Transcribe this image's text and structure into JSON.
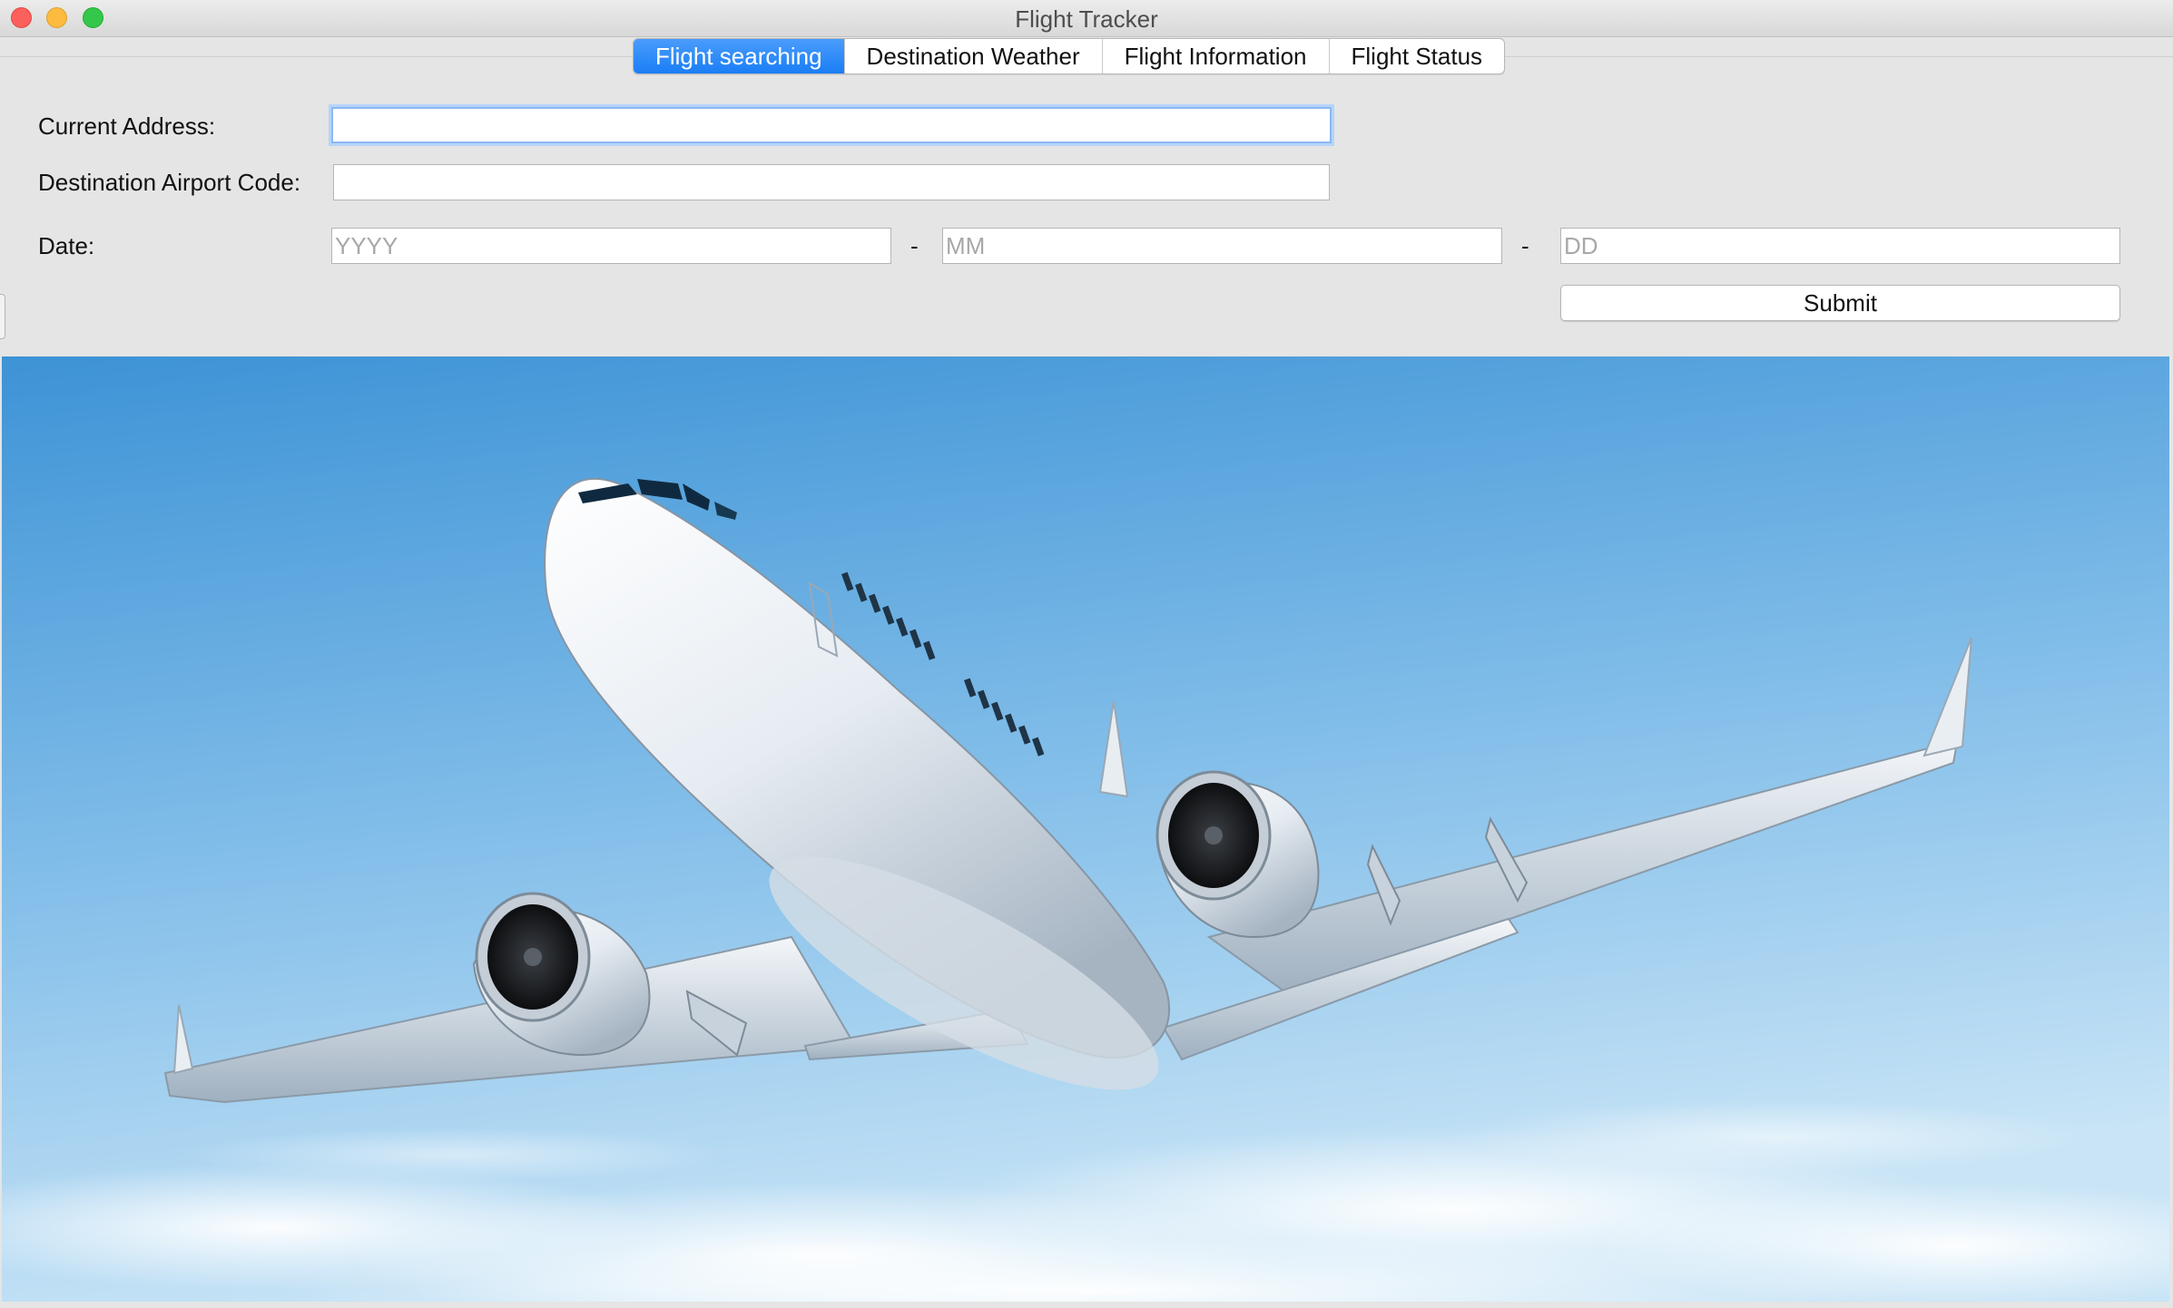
{
  "window": {
    "title": "Flight Tracker"
  },
  "tabs": [
    {
      "label": "Flight searching",
      "active": true
    },
    {
      "label": "Destination Weather",
      "active": false
    },
    {
      "label": "Flight Information",
      "active": false
    },
    {
      "label": "Flight Status",
      "active": false
    }
  ],
  "form": {
    "current_address": {
      "label": "Current Address:",
      "value": ""
    },
    "destination_code": {
      "label": "Destination Airport Code:",
      "value": ""
    },
    "date": {
      "label": "Date:",
      "year_placeholder": "YYYY",
      "month_placeholder": "MM",
      "day_placeholder": "DD",
      "separator": "-"
    },
    "submit_label": "Submit"
  },
  "colors": {
    "active_tab": "#1a7ef6",
    "sky_top": "#3d93d6",
    "sky_bottom": "#bfe0f6"
  },
  "image": {
    "subject": "airplane-in-sky"
  }
}
